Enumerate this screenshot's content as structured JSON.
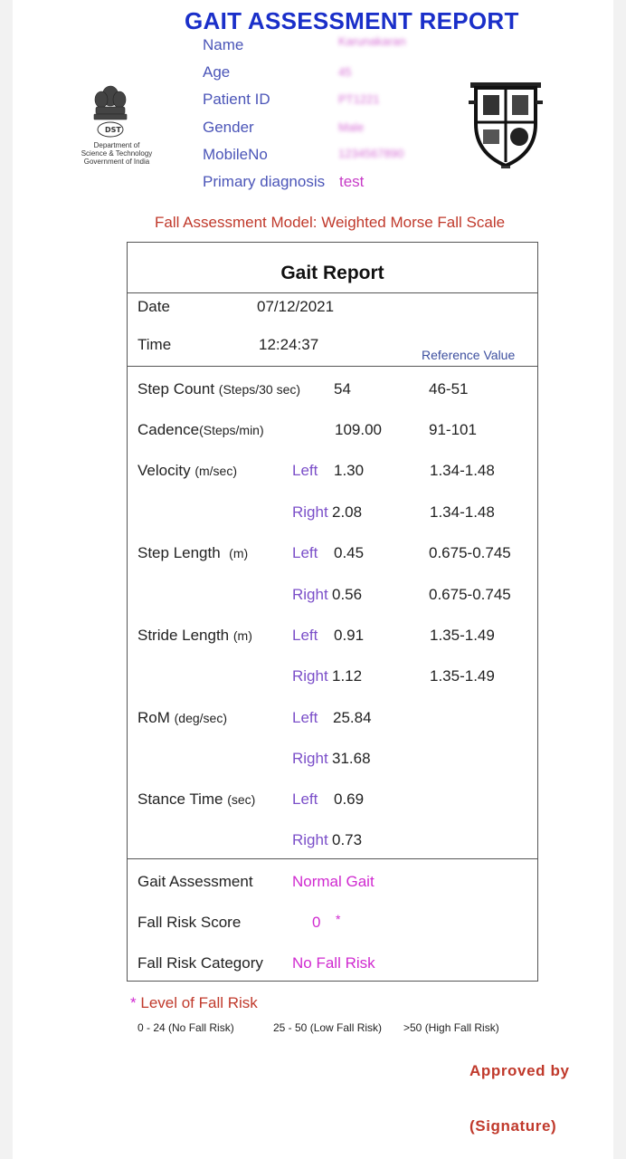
{
  "header": {
    "title": "GAIT ASSESSMENT REPORT",
    "dst_logo_caption": [
      "Department of",
      "Science & Technology",
      "Government of India"
    ]
  },
  "patient": [
    {
      "label": "Name",
      "value": "Karunakaran",
      "obscured": true
    },
    {
      "label": "Age",
      "value": "45",
      "obscured": true
    },
    {
      "label": "Patient ID",
      "value": "PT1221",
      "obscured": true
    },
    {
      "label": "Gender",
      "value": "Male",
      "obscured": true
    },
    {
      "label": "MobileNo",
      "value": "1234567890",
      "obscured": true
    },
    {
      "label": "Primary diagnosis",
      "value": "test",
      "obscured": false
    }
  ],
  "model_line": "Fall Assessment Model: Weighted Morse Fall Scale",
  "report": {
    "title": "Gait Report",
    "date_label": "Date",
    "date_value": "07/12/2021",
    "time_label": "Time",
    "time_value": "12:24:37",
    "reference_header": "Reference Value",
    "metrics": [
      {
        "name": "Step Count",
        "unit": "(Steps/30 sec)",
        "value": "54",
        "ref": "46-51"
      },
      {
        "name": "Cadence",
        "unit": "(Steps/min)",
        "value": "109.00",
        "ref": "91-101"
      },
      {
        "name": "Velocity",
        "unit": "(m/sec)",
        "left": "1.30",
        "left_ref": "1.34-1.48",
        "right": "2.08",
        "right_ref": "1.34-1.48"
      },
      {
        "name": "Step Length",
        "unit": "(m)",
        "left": "0.45",
        "left_ref": "0.675-0.745",
        "right": "0.56",
        "right_ref": "0.675-0.745"
      },
      {
        "name": "Stride Length",
        "unit": "(m)",
        "left": "0.91",
        "left_ref": "1.35-1.49",
        "right": "1.12",
        "right_ref": "1.35-1.49"
      },
      {
        "name": "RoM",
        "unit": "(deg/sec)",
        "left": "25.84",
        "right": "31.68"
      },
      {
        "name": "Stance Time",
        "unit": "(sec)",
        "left": "0.69",
        "right": "0.73"
      }
    ],
    "left_label": "Left",
    "right_label": "Right",
    "assessment": {
      "gait_label": "Gait Assessment",
      "gait_value": "Normal Gait",
      "score_label": "Fall Risk Score",
      "score_value": "0",
      "score_marker": "*",
      "category_label": "Fall Risk Category",
      "category_value": "No Fall Risk"
    }
  },
  "legend": {
    "marker": "*",
    "title": "Level of Fall Risk",
    "levels": [
      "0 - 24 (No Fall Risk)",
      "25 - 50 (Low Fall Risk)",
      ">50 (High Fall Risk)"
    ]
  },
  "approved": "Approved by",
  "signature": "(Signature)",
  "icons": [
    "dst-emblem-logo",
    "institution-crest-logo"
  ],
  "colors": {
    "title": "#1a2fc9",
    "label": "#4b55b8",
    "value": "#d02ad0",
    "accent_red": "#c0392b"
  }
}
